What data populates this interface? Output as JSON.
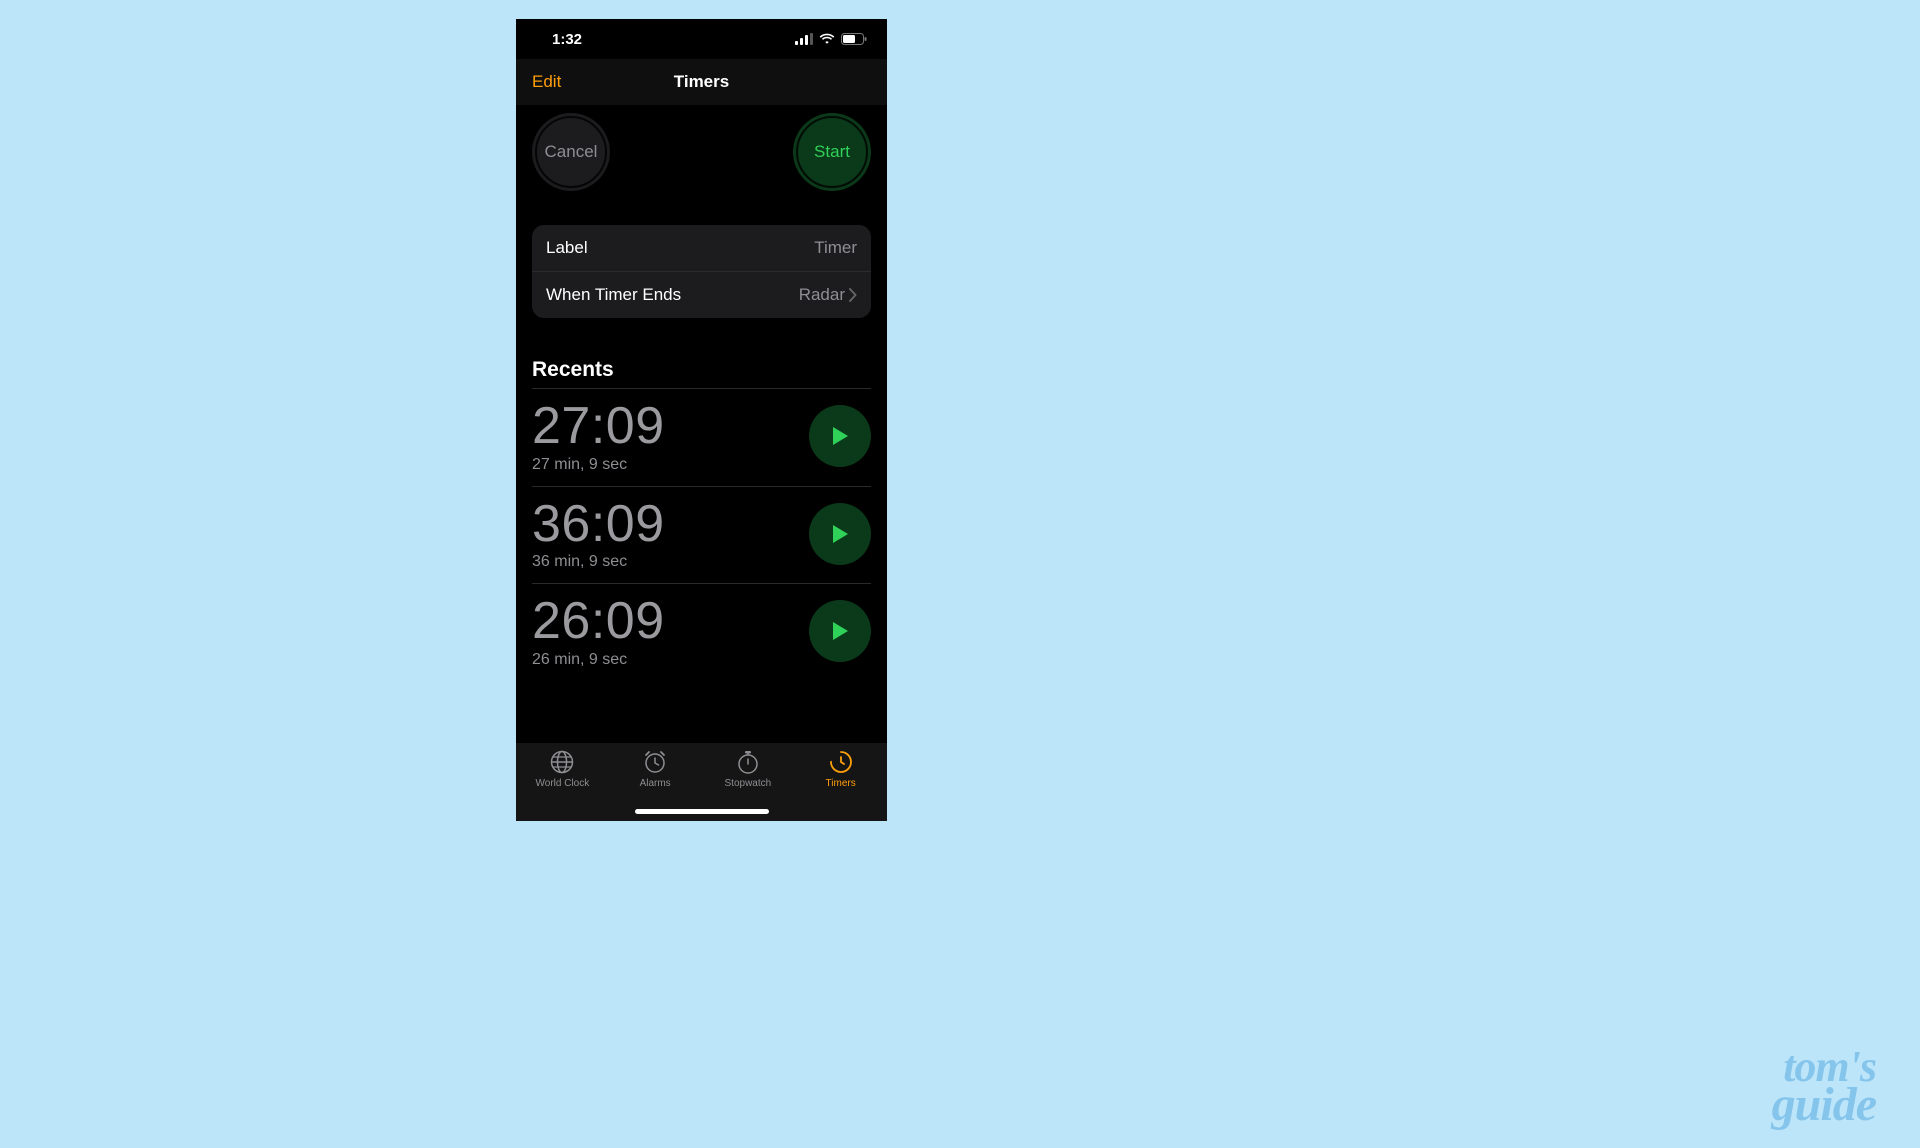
{
  "statusBar": {
    "time": "1:32"
  },
  "nav": {
    "edit": "Edit",
    "title": "Timers"
  },
  "buttons": {
    "cancel": "Cancel",
    "start": "Start"
  },
  "settings": {
    "labelTitle": "Label",
    "labelValue": "Timer",
    "endsTitle": "When Timer Ends",
    "endsValue": "Radar"
  },
  "recents": {
    "header": "Recents",
    "items": [
      {
        "time": "27:09",
        "subtitle": "27 min, 9 sec"
      },
      {
        "time": "36:09",
        "subtitle": "36 min, 9 sec"
      },
      {
        "time": "26:09",
        "subtitle": "26 min, 9 sec"
      }
    ]
  },
  "tabs": {
    "worldClock": "World Clock",
    "alarms": "Alarms",
    "stopwatch": "Stopwatch",
    "timers": "Timers"
  },
  "watermark": {
    "line1": "tom's",
    "line2": "guide"
  }
}
